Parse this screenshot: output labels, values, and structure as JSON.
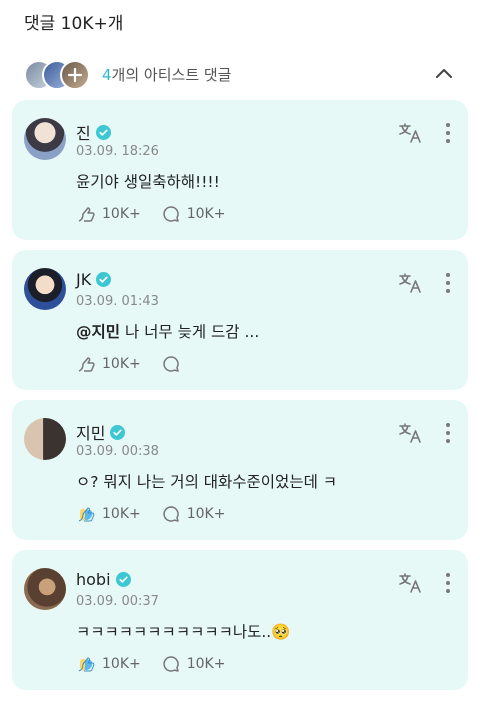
{
  "header": {
    "title": "댓글 10K+개"
  },
  "artist_bar": {
    "count": "4",
    "text": "개의 아티스트 댓글"
  },
  "comments": [
    {
      "author": "진",
      "time": "03.09. 18:26",
      "mention": "",
      "text": "윤기야 생일축하해!!!!",
      "likes": "10K+",
      "replies": "10K+"
    },
    {
      "author": "JK",
      "time": "03.09. 01:43",
      "mention": "@지민",
      "text": " 나 너무 늦게 드감 ...",
      "likes": "10K+",
      "replies": ""
    },
    {
      "author": "지민",
      "time": "03.09. 00:38",
      "mention": "",
      "text": "ㅇ? 뭐지 나는 거의 대화수준이었는데 ㅋ",
      "likes": "10K+",
      "replies": "10K+"
    },
    {
      "author": "hobi",
      "time": "03.09. 00:37",
      "mention": "",
      "text": "ㅋㅋㅋㅋㅋㅋㅋㅋㅋㅋㅋ나도..",
      "emoji": "🥺",
      "likes": "10K+",
      "replies": "10K+"
    }
  ],
  "colors": {
    "card_bg": "#e6f9f6",
    "accent": "#2fb8c8",
    "verified": "#3cc7d3"
  }
}
